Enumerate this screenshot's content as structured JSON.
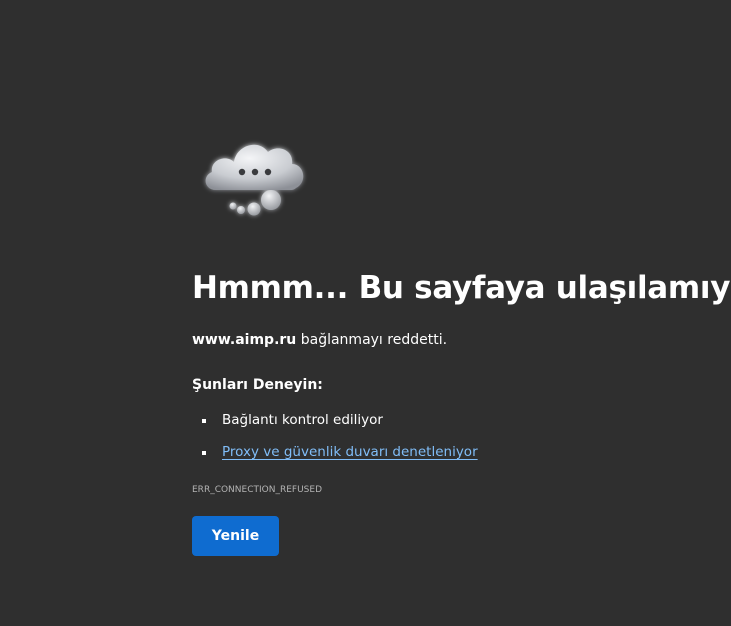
{
  "error_page": {
    "title": "Hmmm... Bu sayfaya ulaşılamıyor",
    "host": "www.aimp.ru",
    "summary_suffix": " bağlanmayı reddetti.",
    "suggestions_heading": "Şunları Deneyin:",
    "suggestions": [
      {
        "text": "Bağlantı kontrol ediliyor",
        "is_link": false
      },
      {
        "text": "Proxy ve güvenlik duvarı denetleniyor",
        "is_link": true
      }
    ],
    "error_code": "ERR_CONNECTION_REFUSED",
    "reload_label": "Yenile",
    "illustration_icon": "cloud-thinking-icon"
  },
  "colors": {
    "background": "#2f2f2f",
    "link": "#80bdf7",
    "button": "#0f6cd0",
    "muted_text": "#b3b3b3"
  }
}
